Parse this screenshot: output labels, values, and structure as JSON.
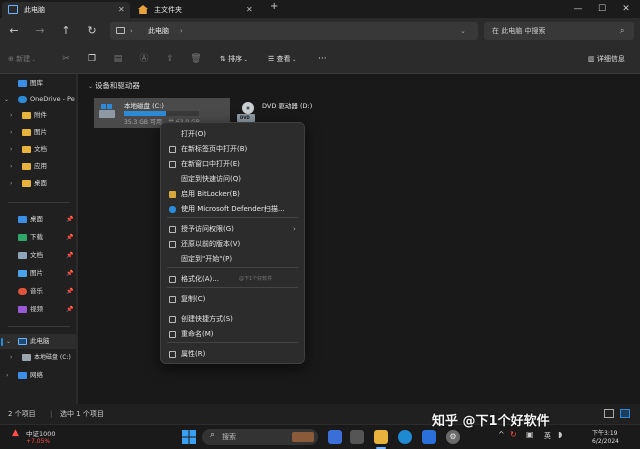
{
  "tabs": [
    {
      "label": "此电脑"
    },
    {
      "label": "主文件夹"
    }
  ],
  "new_tab_symbol": "+",
  "window": {
    "minimize": "—",
    "maximize": "☐",
    "close": "✕"
  },
  "address": {
    "location": "此电脑",
    "search_placeholder": "在 此电脑 中搜索"
  },
  "commands": {
    "new": "新建",
    "sort": "排序",
    "view": "查看",
    "more": "···",
    "details": "详细信息"
  },
  "sidebar": {
    "items": [
      {
        "label": "图库"
      },
      {
        "label": "OneDrive - Pe"
      },
      {
        "label": "附件"
      },
      {
        "label": "图片"
      },
      {
        "label": "文档"
      },
      {
        "label": "应用"
      },
      {
        "label": "桌面"
      }
    ],
    "quick": [
      {
        "label": "桌面"
      },
      {
        "label": "下载"
      },
      {
        "label": "文档"
      },
      {
        "label": "图片"
      },
      {
        "label": "音乐"
      },
      {
        "label": "视频"
      }
    ],
    "this_pc": "此电脑",
    "local_disk": "本地磁盘 (C:)",
    "network": "网络"
  },
  "main": {
    "section_title": "设备和驱动器",
    "drive_c": {
      "name": "本地磁盘 (C:)",
      "usage": 0.56,
      "size_text": "35.3 GB 可用，共 63.0 GB"
    },
    "drive_d": {
      "name": "DVD 驱动器 (D:)",
      "badge": "DVD"
    }
  },
  "context_menu": [
    {
      "label": "打开(O)",
      "icon": "none"
    },
    {
      "label": "在新标签页中打开(B)",
      "icon": "tab-icon"
    },
    {
      "label": "在新窗口中打开(E)",
      "icon": "window-icon"
    },
    {
      "label": "固定到快速访问(Q)",
      "icon": "none"
    },
    {
      "label": "启用 BitLocker(B)",
      "icon": "bitlocker-icon"
    },
    {
      "label": "使用 Microsoft Defender扫描...",
      "icon": "defender-icon"
    },
    {
      "label": "授予访问权限(G)",
      "icon": "share-icon",
      "submenu": true
    },
    {
      "label": "还原以前的版本(V)",
      "icon": "restore-icon"
    },
    {
      "label": "固定到\"开始\"(P)",
      "icon": "none"
    },
    {
      "label": "格式化(A)...",
      "icon": "format-icon",
      "shortcut": "@下1个好软件"
    },
    {
      "label": "复制(C)",
      "icon": "copy-icon"
    },
    {
      "label": "创建快捷方式(S)",
      "icon": "link-icon"
    },
    {
      "label": "重命名(M)",
      "icon": "rename-icon"
    },
    {
      "label": "属性(R)",
      "icon": "properties-icon"
    }
  ],
  "status": {
    "count": "2 个项目",
    "selected": "选中 1 个项目"
  },
  "taskbar": {
    "stock_name": "中证1000",
    "stock_change": "+7.05%",
    "search": "搜索",
    "lang": "英",
    "time": "下午3:19",
    "date": "6/2/2024"
  },
  "watermark": "知乎 @下1个好软件",
  "colors": {
    "accent": "#2b8bd8",
    "stock_up": "#ff4d4d"
  }
}
